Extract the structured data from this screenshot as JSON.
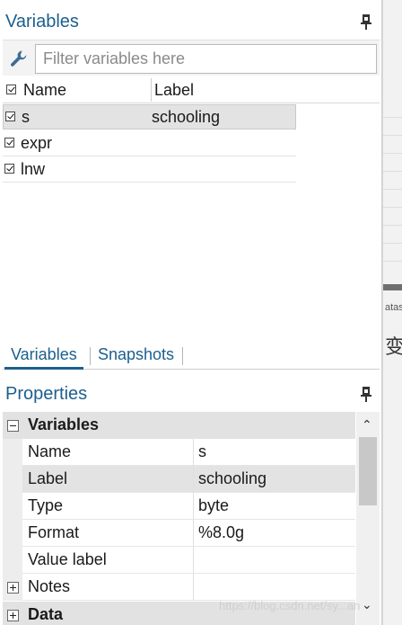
{
  "variables_panel": {
    "title": "Variables",
    "filter_placeholder": "Filter variables here",
    "columns": {
      "name": "Name",
      "label": "Label"
    },
    "rows": [
      {
        "name": "s",
        "label": "schooling",
        "checked": true
      },
      {
        "name": "expr",
        "label": "",
        "checked": true
      },
      {
        "name": "lnw",
        "label": "",
        "checked": true
      }
    ]
  },
  "tabs": [
    {
      "label": "Variables"
    },
    {
      "label": "Snapshots"
    }
  ],
  "properties_panel": {
    "title": "Properties",
    "group_variables": "Variables",
    "rows": [
      {
        "key": "Name",
        "value": "s"
      },
      {
        "key": "Label",
        "value": "schooling"
      },
      {
        "key": "Type",
        "value": "byte"
      },
      {
        "key": "Format",
        "value": "%8.0g"
      },
      {
        "key": "Value label",
        "value": ""
      },
      {
        "key": "Notes",
        "value": ""
      }
    ],
    "group_data": "Data"
  },
  "background": {
    "fragment": "atas",
    "cjk_char": "变"
  },
  "watermark": "https://blog.csdn.net/sy...an",
  "colors": {
    "accent": "#1c5f8e",
    "selection": "#e3e3e3",
    "group_bg": "#e2e2e2"
  },
  "icons": [
    "pin-icon",
    "wrench-icon",
    "checkbox-checked-icon",
    "expand-minus-icon",
    "expand-plus-icon",
    "scroll-up-icon",
    "scroll-down-icon"
  ]
}
